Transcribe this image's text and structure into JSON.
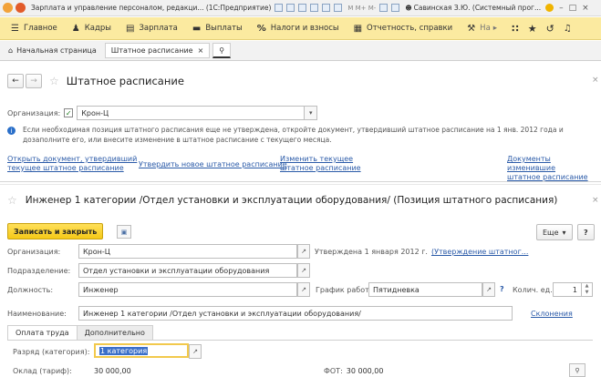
{
  "titlebar": {
    "title": "Зарплата и управление персоналом, редакци... (1С:Предприятие)",
    "user": "Савинская З.Ю. (Системный прог..."
  },
  "sections": [
    {
      "icon": "menu-icon",
      "label": "Главное"
    },
    {
      "icon": "people-icon",
      "label": "Кадры"
    },
    {
      "icon": "doc-icon",
      "label": "Зарплата"
    },
    {
      "icon": "wallet-icon",
      "label": "Выплаты"
    },
    {
      "icon": "percent-icon",
      "label": "Налоги и взносы"
    },
    {
      "icon": "report-icon",
      "label": "Отчетность, справки"
    },
    {
      "icon": "tools-icon",
      "label": "На"
    }
  ],
  "tabs": {
    "home": "Начальная страница",
    "staffing": "Штатное расписание"
  },
  "top_form": {
    "title": "Штатное расписание",
    "org_label": "Организация:",
    "org_value": "Крон-Ц",
    "notice": "Если необходимая позиция штатного расписания еще не утверждена, откройте документ, утвердивший штатное расписание на 1 янв. 2012 года и дозаполните его, или внесите изменение в штатное расписание с текущего месяца.",
    "link_open_line1": "Открыть документ, утвердивший",
    "link_open_line2": "текущее штатное расписание",
    "link_approve": "Утвердить новое штатное расписание",
    "link_change_line1": "Изменить текущее",
    "link_change_line2": "штатное расписание",
    "link_docs_line1": "Документы изменившие",
    "link_docs_line2": "штатное расписание"
  },
  "form": {
    "title": "Инженер 1 категории /Отдел установки и эксплуатации оборудования/ (Позиция штатного расписания)",
    "save_close": "Записать и закрыть",
    "more": "Еще",
    "help": "?",
    "org_label": "Организация:",
    "org_value": "Крон-Ц",
    "approved_text": "Утверждена 1 января 2012 г.",
    "approved_link": "(Утверждение штатног...",
    "dept_label": "Подразделение:",
    "dept_value": "Отдел установки и эксплуатации оборудования",
    "position_label": "Должность:",
    "position_value": "Инженер",
    "schedule_label": "График работы:",
    "schedule_value": "Пятидневка",
    "count_label": "Колич. ед.:",
    "count_value": "1",
    "name_label": "Наименование:",
    "name_value": "Инженер 1 категории /Отдел установки и эксплуатации оборудования/",
    "declension_link": "Склонения",
    "subtab_pay": "Оплата труда",
    "subtab_extra": "Дополнительно",
    "grade_label": "Разряд (категория):",
    "grade_value": "1 категория",
    "salary_label": "Оклад (тариф):",
    "salary_value": "30 000,00",
    "fot_label": "ФОТ:",
    "fot_value": "30 000,00"
  },
  "colors": {
    "section_bar": "#fbeaa0",
    "primary_button": "#f5c917",
    "link": "#2a5aa8"
  }
}
